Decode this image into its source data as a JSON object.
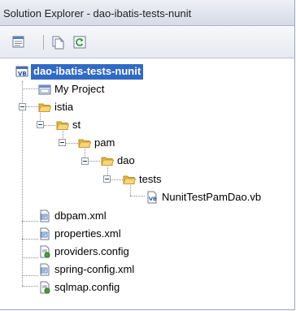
{
  "window": {
    "title": "Solution Explorer - dao-ibatis-tests-nunit"
  },
  "toolbar": {
    "buttons": [
      {
        "name": "properties-icon"
      },
      {
        "name": "show-all-files-icon"
      },
      {
        "name": "refresh-icon"
      }
    ]
  },
  "tree": {
    "project": "dao-ibatis-tests-nunit",
    "my_project": "My Project",
    "istia": "istia",
    "st": "st",
    "pam": "pam",
    "dao": "dao",
    "tests": "tests",
    "test_file": "NunitTestPamDao.vb",
    "files": [
      "dbpam.xml",
      "properties.xml",
      "providers.config",
      "spring-config.xml",
      "sqlmap.config"
    ]
  },
  "colors": {
    "selection": "#316ac5",
    "folder": "#f2c34a"
  }
}
